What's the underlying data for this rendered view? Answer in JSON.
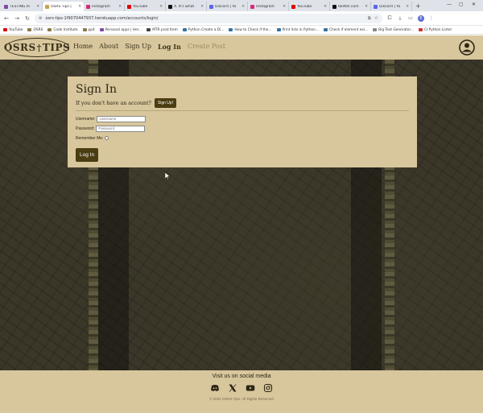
{
  "browser": {
    "tabs": [
      {
        "title": "TESTING.m",
        "color": "#7d4ba6",
        "active": false
      },
      {
        "title": "OSRS Tips |",
        "color": "#c8a24a",
        "active": true
      },
      {
        "title": "Instagram",
        "color": "#d62976",
        "active": false
      },
      {
        "title": "YouTube",
        "color": "#e00000",
        "active": false
      },
      {
        "title": "X. It's what",
        "color": "#111111",
        "active": false
      },
      {
        "title": "Discord | Yo",
        "color": "#5865f2",
        "active": false
      },
      {
        "title": "Instagram",
        "color": "#d62976",
        "active": false
      },
      {
        "title": "YouTube",
        "color": "#e00000",
        "active": false
      },
      {
        "title": "twitter.com",
        "color": "#111111",
        "active": false
      },
      {
        "title": "Discord | Yo",
        "color": "#5865f2",
        "active": false
      }
    ],
    "new_tab": "+",
    "url": "osrs-tips-1f9070447937.herokuapp.com/accounts/login/",
    "profile_initial": "E",
    "bookmarks": [
      {
        "label": "YouTube",
        "color": "#e00000"
      },
      {
        "label": "OSRS",
        "color": "#8a7a4a"
      },
      {
        "label": "Code Institute",
        "color": "#8a7a4a"
      },
      {
        "label": "pp4",
        "color": "#8a7a4a"
      },
      {
        "label": "Personal apps | Her...",
        "color": "#7d4ba6"
      },
      {
        "label": "MTR prod Item",
        "color": "#444444"
      },
      {
        "label": "Python Create a Di...",
        "color": "#3572a5"
      },
      {
        "label": "How to Check if the...",
        "color": "#3572a5"
      },
      {
        "label": "Print lists in Python...",
        "color": "#3572a5"
      },
      {
        "label": "Check if element exi...",
        "color": "#3572a5"
      },
      {
        "label": "Big Text Generator...",
        "color": "#888888"
      },
      {
        "label": "CI Python Linter",
        "color": "#cc3333"
      }
    ]
  },
  "site": {
    "logo_left": "OSRS",
    "logo_right": "TIPS",
    "nav": [
      {
        "label": "Home",
        "state": "normal"
      },
      {
        "label": "About",
        "state": "normal"
      },
      {
        "label": "Sign Up",
        "state": "normal"
      },
      {
        "label": "Log In",
        "state": "current"
      },
      {
        "label": "Create Post",
        "state": "disabled"
      }
    ]
  },
  "signin": {
    "title": "Sign In",
    "prompt": "If you don't have an account?",
    "signup_button": "Sign Up!",
    "username_label": "Username:",
    "username_placeholder": "Username",
    "password_label": "Password:",
    "password_placeholder": "Password",
    "remember_label": "Remember Me:",
    "login_button": "Log In"
  },
  "footer": {
    "visit_text": "Visit us on social media",
    "copyright": "© 2024 OSRS Tips. All Rights Reserved",
    "socials": [
      "discord-icon",
      "x-icon",
      "youtube-icon",
      "instagram-icon"
    ]
  },
  "colors": {
    "tan": "#d8c69c",
    "button_brown": "#4a3d12",
    "text_dark": "#2c2616"
  }
}
